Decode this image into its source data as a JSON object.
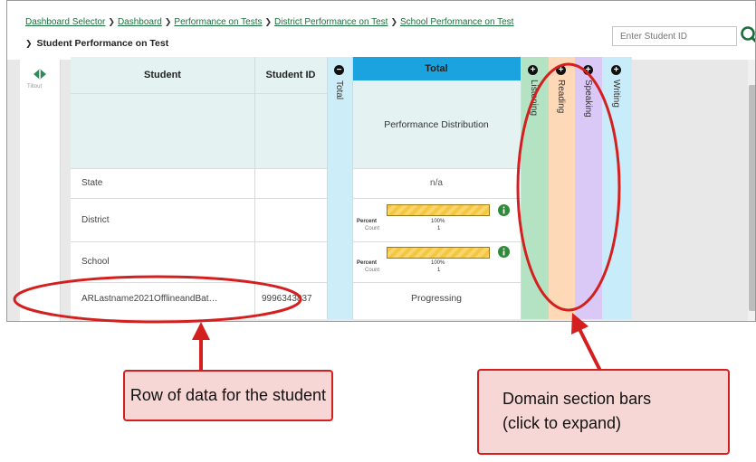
{
  "breadcrumb": {
    "items": [
      "Dashboard Selector",
      "Dashboard",
      "Performance on Tests",
      "District Performance on Test",
      "School Performance on Test"
    ],
    "current": "Student Performance on Test"
  },
  "search": {
    "placeholder": "Enter Student ID",
    "icon": "magnifier"
  },
  "rail": {
    "label": "Tiltout"
  },
  "table": {
    "headers": {
      "student": "Student",
      "student_id": "Student ID",
      "total_collapsed": "Total",
      "total": "Total"
    },
    "performance_distribution_label": "Performance Distribution",
    "domains": [
      {
        "label": "Listening",
        "color": "#b4e3c4",
        "toggle": "+"
      },
      {
        "label": "Reading",
        "color": "#fdd9b8",
        "toggle": "+"
      },
      {
        "label": "Speaking",
        "color": "#dac9f6",
        "toggle": "+"
      },
      {
        "label": "Writing",
        "color": "#c9ecfb",
        "toggle": "+"
      }
    ],
    "total_toggle": "−",
    "rows": [
      {
        "name": "State",
        "id": "",
        "total": "n/a"
      },
      {
        "name": "District",
        "id": "",
        "percent_label": "Percent",
        "count_label": "Count",
        "percent": "100%",
        "count": "1",
        "fill": 1.0
      },
      {
        "name": "School",
        "id": "",
        "percent_label": "Percent",
        "count_label": "Count",
        "percent": "100%",
        "count": "1",
        "fill": 1.0
      },
      {
        "name": "ARLastname2021OfflineandBat…",
        "id": "9996343837",
        "total": "Progressing"
      }
    ]
  },
  "callouts": {
    "row": "Row of data for the student",
    "domain": "Domain section bars (click to expand)"
  },
  "colors": {
    "header_blue": "#1aa3de",
    "total_collapsed_col": "#cdeef9",
    "header_bg": "#e4f3f2",
    "annotation_red": "#d41f1f",
    "link_green": "#1a6f3c"
  }
}
